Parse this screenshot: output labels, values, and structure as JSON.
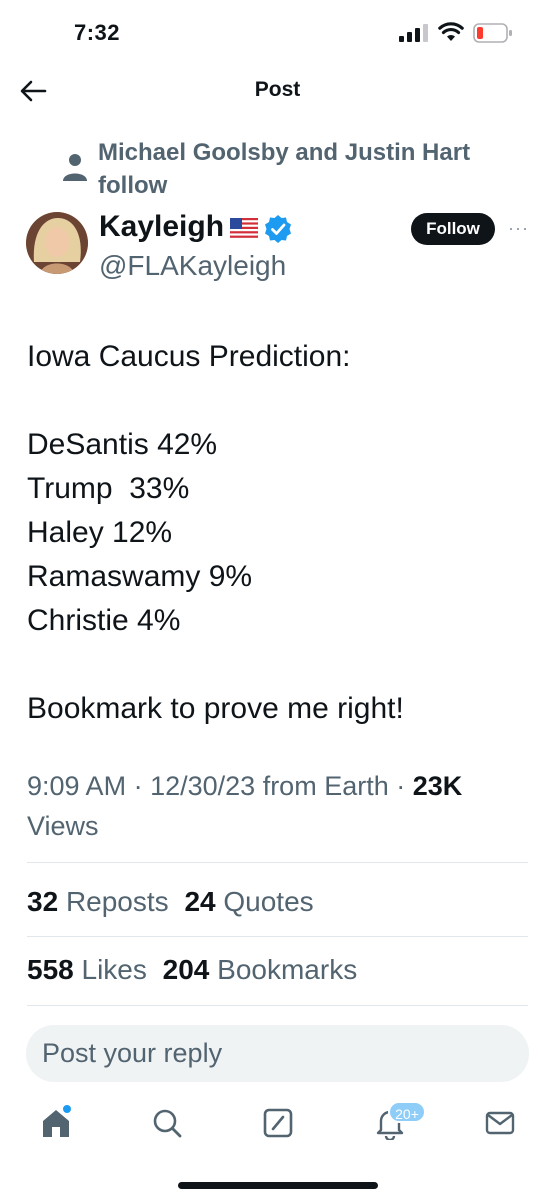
{
  "status_bar": {
    "time": "7:32"
  },
  "nav": {
    "title": "Post"
  },
  "social_context": {
    "text": "Michael Goolsby and Justin Hart follow"
  },
  "author": {
    "name": "Kayleigh",
    "handle": "@FLAKayleigh",
    "follow_label": "Follow",
    "flag": "us-flag-emoji",
    "verified_icon": "verified-badge-icon"
  },
  "tweet": {
    "lines": [
      "Iowa Caucus Prediction:",
      "",
      "DeSantis 42%",
      "Trump  33%",
      "Haley 12%",
      "Ramaswamy 9%",
      "Christie 4%",
      "",
      "Bookmark to prove me right!"
    ]
  },
  "meta": {
    "time": "9:09 AM",
    "date": "12/30/23",
    "source": "from Earth",
    "views_count": "23K",
    "views_label": "Views"
  },
  "stats": {
    "reposts_count": "32",
    "reposts_label": "Reposts",
    "quotes_count": "24",
    "quotes_label": "Quotes",
    "likes_count": "558",
    "likes_label": "Likes",
    "bookmarks_count": "204",
    "bookmarks_label": "Bookmarks"
  },
  "reply": {
    "placeholder": "Post your reply"
  },
  "tab_bar": {
    "items": [
      "home-icon",
      "search-icon",
      "compose-icon",
      "notifications-icon",
      "messages-icon"
    ],
    "notif_badge": "20+"
  },
  "colors": {
    "text_primary": "#0f1419",
    "text_secondary": "#536471",
    "accent": "#1d9bf0",
    "badge": "#8ecdf8",
    "battery_low": "#ff3b30"
  }
}
